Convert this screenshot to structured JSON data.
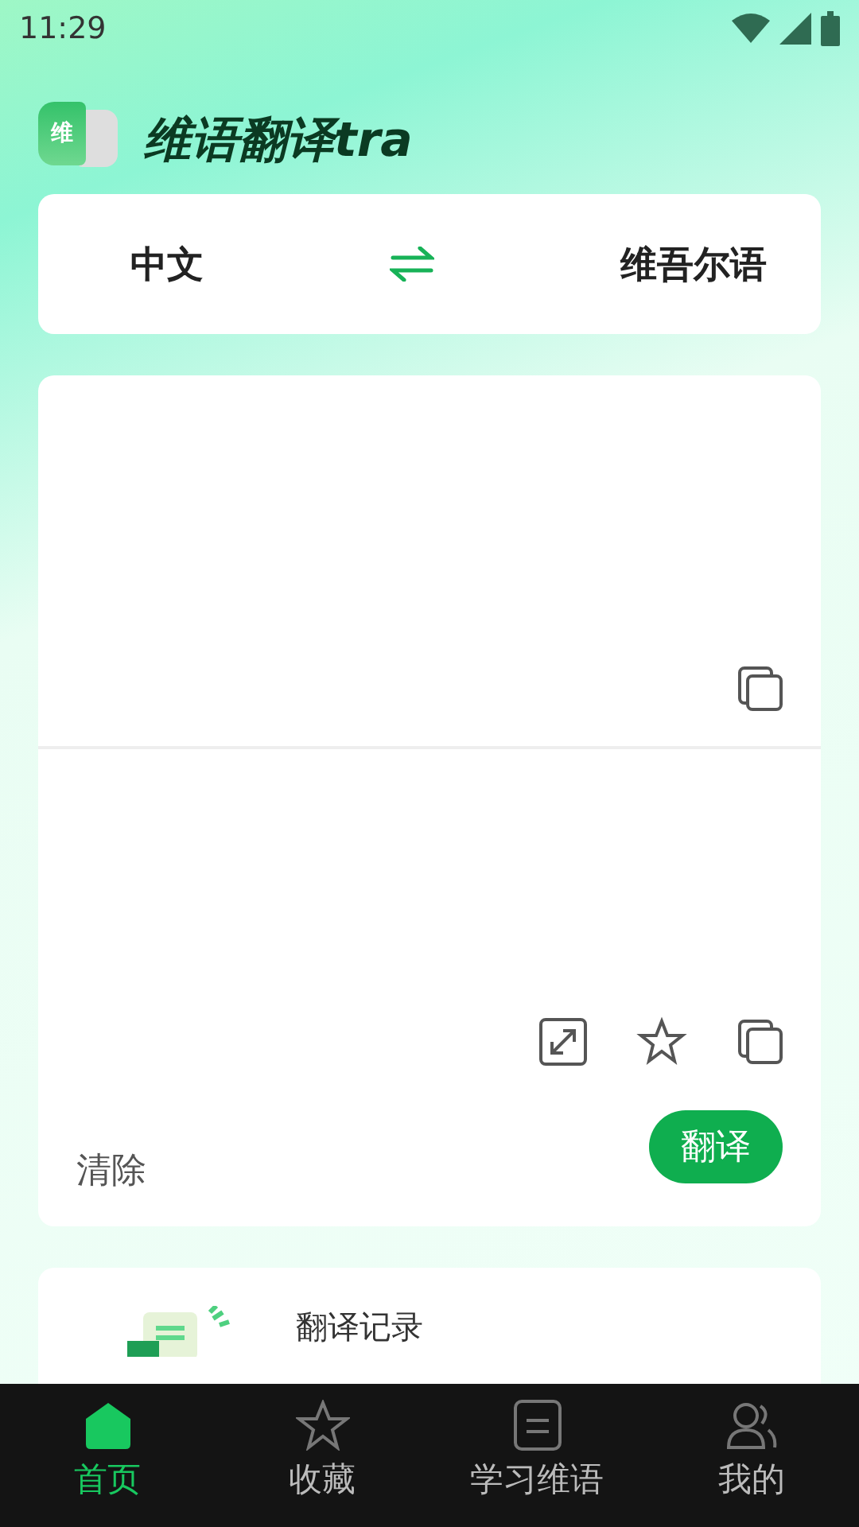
{
  "status_bar": {
    "time": "11:29"
  },
  "app": {
    "logo_char": "维",
    "title": "维语翻译tra"
  },
  "languages": {
    "source": "中文",
    "target": "维吾尔语"
  },
  "translator": {
    "clear": "清除",
    "translate": "翻译"
  },
  "history": {
    "title": "翻译记录"
  },
  "nav": [
    {
      "label": "首页",
      "kind": "home",
      "selected": true
    },
    {
      "label": "收藏",
      "kind": "star",
      "selected": false
    },
    {
      "label": "学习维语",
      "kind": "book",
      "selected": false
    },
    {
      "label": "我的",
      "kind": "user",
      "selected": false
    }
  ]
}
